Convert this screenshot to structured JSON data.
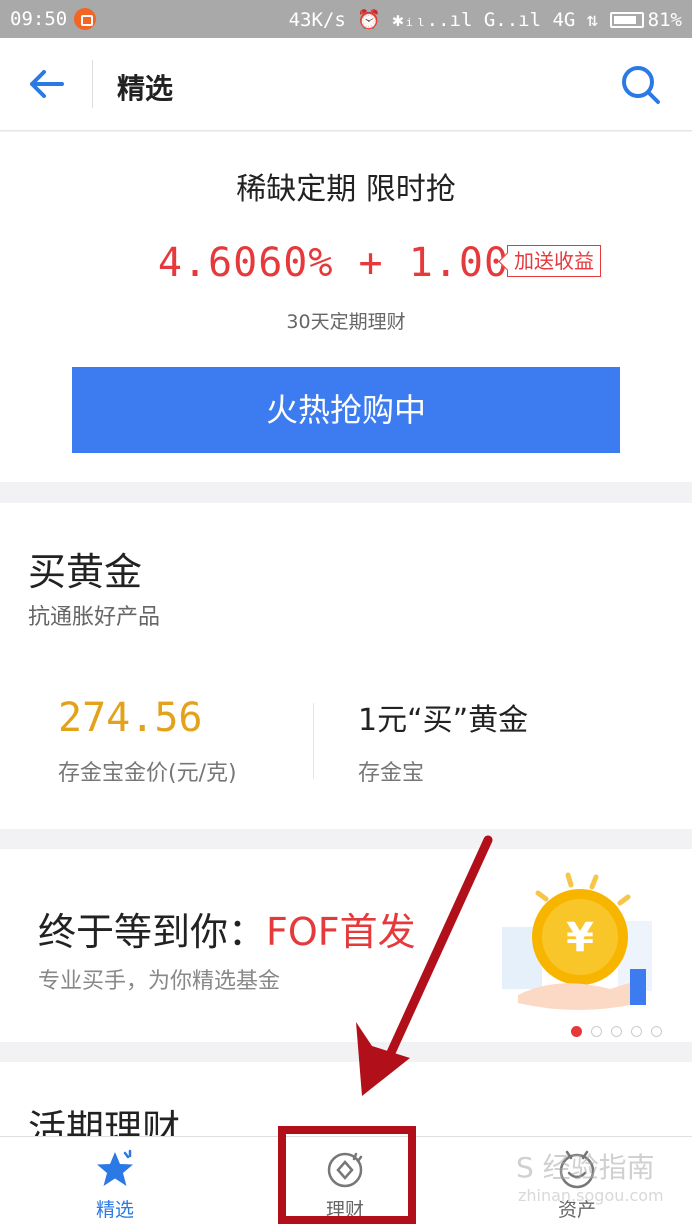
{
  "status_bar": {
    "time": "09:50",
    "right_text": "43K/s ⏰ ✱ᵢₗ..ıl G..ıl 4G ⇅",
    "battery": "81%"
  },
  "header": {
    "title": "精选"
  },
  "promo": {
    "title": "稀缺定期 限时抢",
    "rate": "4.6060% + 1.00%",
    "bonus_tag": "加送收益",
    "term": "30天定期理财",
    "button": "火热抢购中"
  },
  "gold": {
    "title": "买黄金",
    "subtitle": "抗通胀好产品",
    "price": "274.56",
    "price_label": "存金宝金价(元/克)",
    "offer": "1元“买”黄金",
    "offer_label": "存金宝"
  },
  "banner": {
    "title_prefix": "终于等到你：",
    "title_highlight": "FOF首发",
    "subtitle": "专业买手，为你精选基金",
    "dots_count": 5,
    "active_dot": 1,
    "coin_symbol": "¥"
  },
  "current": {
    "title": "活期理财"
  },
  "tabbar": {
    "tabs": [
      {
        "label": "精选",
        "icon": "star-icon",
        "active": true
      },
      {
        "label": "理财",
        "icon": "wealth-icon",
        "active": false
      },
      {
        "label": "资产",
        "icon": "assets-icon",
        "active": false
      }
    ]
  },
  "watermark": {
    "text": "S 经验指南",
    "url": "zhinan.sogou.com"
  },
  "colors": {
    "accent_blue": "#3c7cf0",
    "rate_red": "#e5393b",
    "gold_price": "#e3a21a",
    "annotation_red": "#b1101a"
  }
}
